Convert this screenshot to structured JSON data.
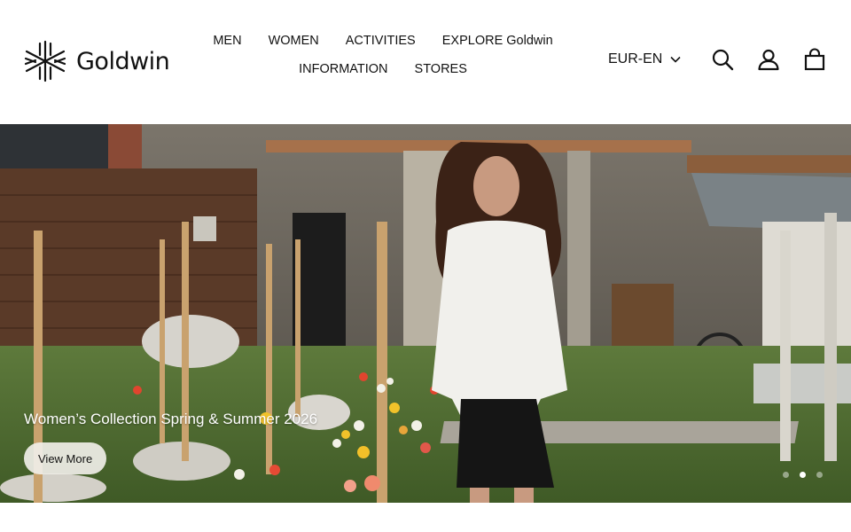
{
  "brand": {
    "name": "Goldwin",
    "logo_icon": "goldwin-star-icon"
  },
  "nav": {
    "row1": [
      "MEN",
      "WOMEN",
      "ACTIVITIES",
      "EXPLORE Goldwin"
    ],
    "row2": [
      "INFORMATION",
      "STORES"
    ]
  },
  "currency": {
    "label": "EUR-EN",
    "icon": "chevron-down-icon"
  },
  "header_icons": {
    "search": "search-icon",
    "account": "account-icon",
    "cart": "cart-icon"
  },
  "hero": {
    "title": "Women’s Collection Spring & Summer 2026",
    "button_label": "View More",
    "slides": 3,
    "active_slide": 2
  }
}
